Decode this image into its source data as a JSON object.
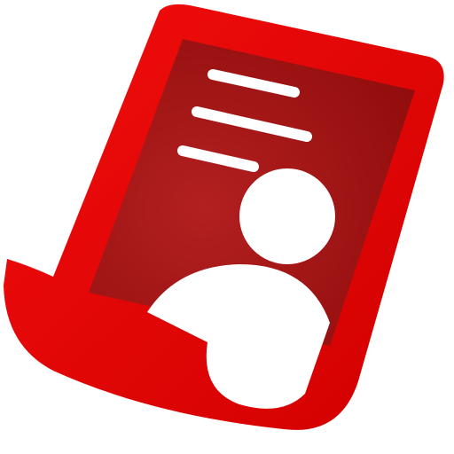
{
  "icon": {
    "name": "resume-document-icon",
    "text_lines": 3,
    "colors": {
      "background": "#ffffff",
      "frame_light": "#f20d0d",
      "frame_dark": "#d10000",
      "panel_light": "#b32020",
      "panel_dark": "#8f0b0b",
      "foreground": "#ffffff"
    }
  }
}
